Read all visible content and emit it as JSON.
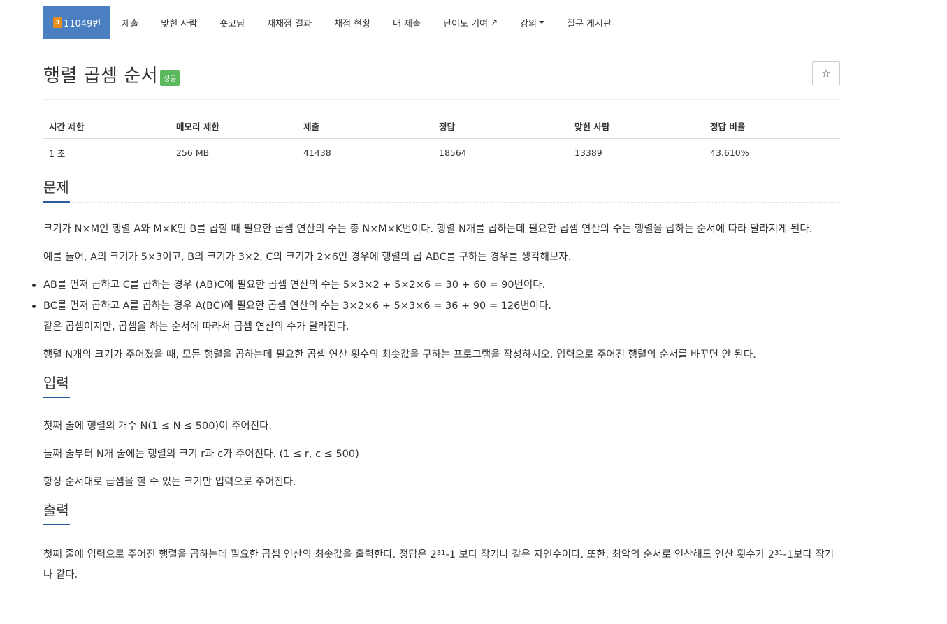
{
  "nav": {
    "problem_tier": "3",
    "problem_number": "11049번",
    "items": [
      "제출",
      "맞힌 사람",
      "숏코딩",
      "재채점 결과",
      "채점 현황",
      "내 제출",
      "난이도 기여",
      "강의",
      "질문 게시판"
    ]
  },
  "problem": {
    "title": "행렬 곱셈 순서",
    "status_badge": "성공",
    "star_label": "☆"
  },
  "info_table": {
    "headers": [
      "시간 제한",
      "메모리 제한",
      "제출",
      "정답",
      "맞힌 사람",
      "정답 비율"
    ],
    "values": [
      "1 초",
      "256 MB",
      "41438",
      "18564",
      "13389",
      "43.610%"
    ]
  },
  "sections": {
    "description": {
      "heading": "문제",
      "p1": "크기가 N×M인 행렬 A와 M×K인 B를 곱할 때 필요한 곱셈 연산의 수는 총 N×M×K번이다. 행렬 N개를 곱하는데 필요한 곱셈 연산의 수는 행렬을 곱하는 순서에 따라 달라지게 된다.",
      "p2": "예를 들어, A의 크기가 5×3이고, B의 크기가 3×2, C의 크기가 2×6인 경우에 행렬의 곱 ABC를 구하는 경우를 생각해보자.",
      "bullets": [
        "AB를 먼저 곱하고 C를 곱하는 경우 (AB)C에 필요한 곱셈 연산의 수는 5×3×2 + 5×2×6 = 30 + 60 = 90번이다.",
        "BC를 먼저 곱하고 A를 곱하는 경우 A(BC)에 필요한 곱셈 연산의 수는 3×2×6 + 5×3×6 = 36 + 90 = 126번이다."
      ],
      "p3": "같은 곱셈이지만, 곱셈을 하는 순서에 따라서 곱셈 연산의 수가 달라진다.",
      "p4": "행렬 N개의 크기가 주어졌을 때, 모든 행렬을 곱하는데 필요한 곱셈 연산 횟수의 최솟값을 구하는 프로그램을 작성하시오. 입력으로 주어진 행렬의 순서를 바꾸면 안 된다."
    },
    "input": {
      "heading": "입력",
      "p1": "첫째 줄에 행렬의 개수 N(1 ≤ N ≤ 500)이 주어진다.",
      "p2": "둘째 줄부터 N개 줄에는 행렬의 크기 r과 c가 주어진다. (1 ≤ r, c ≤ 500)",
      "p3": "항상 순서대로 곱셈을 할 수 있는 크기만 입력으로 주어진다."
    },
    "output": {
      "heading": "출력",
      "part1": "첫째 줄에 입력으로 주어진 행렬을 곱하는데 필요한 곱셈 연산의 최솟값을 출력한다. 정답은 2",
      "exp1": "31",
      "part2": "-1 보다 작거나 같은 자연수이다. 또한, 최악의 순서로 연산해도 연산 횟수가 2",
      "exp2": "31",
      "part3": "-1보다 작거나 같다."
    }
  }
}
